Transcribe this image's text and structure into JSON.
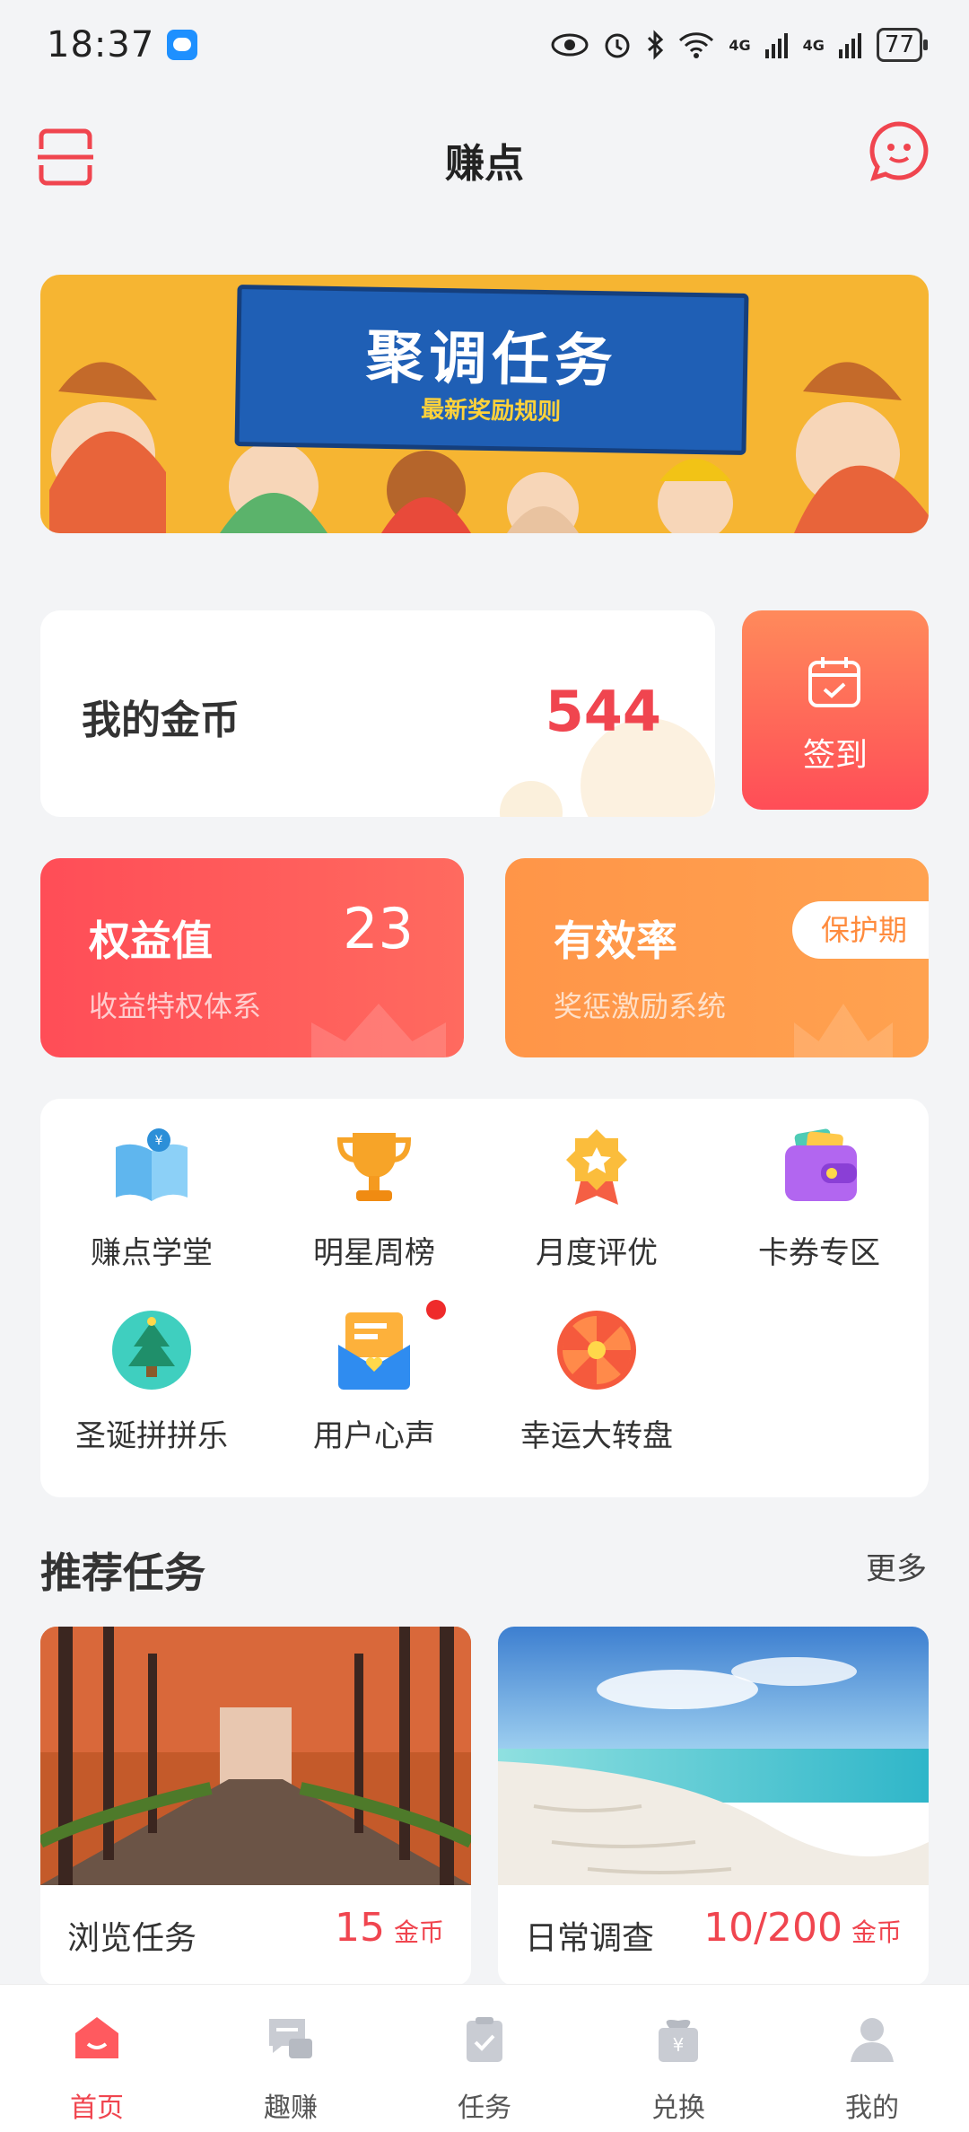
{
  "status_bar": {
    "time": "18:37",
    "battery": "77",
    "signal_labels": [
      "4G",
      "4G"
    ]
  },
  "header": {
    "title": "赚点"
  },
  "banner": {
    "title": "聚调任务",
    "subtitle": "最新奖励规则"
  },
  "coins": {
    "label": "我的金币",
    "value": "544"
  },
  "signin": {
    "label": "签到"
  },
  "rights": {
    "title": "权益值",
    "subtitle": "收益特权体系",
    "value": "23"
  },
  "efficiency": {
    "title": "有效率",
    "subtitle": "奖惩激励系统",
    "badge": "保护期"
  },
  "grid": {
    "items": [
      {
        "label": "赚点学堂",
        "icon": "book-icon"
      },
      {
        "label": "明星周榜",
        "icon": "trophy-icon"
      },
      {
        "label": "月度评优",
        "icon": "medal-icon"
      },
      {
        "label": "卡券专区",
        "icon": "wallet-icon"
      },
      {
        "label": "圣诞拼拼乐",
        "icon": "christmas-tree-icon"
      },
      {
        "label": "用户心声",
        "icon": "mail-heart-icon"
      },
      {
        "label": "幸运大转盘",
        "icon": "lucky-wheel-icon"
      }
    ]
  },
  "recommend": {
    "title": "推荐任务",
    "more": "更多"
  },
  "tasks": [
    {
      "name": "浏览任务",
      "reward": "15",
      "unit": "金币"
    },
    {
      "name": "日常调查",
      "reward": "10/200",
      "unit": "金币"
    }
  ],
  "tabbar": {
    "items": [
      {
        "label": "首页",
        "icon": "home-icon",
        "active": true
      },
      {
        "label": "趣赚",
        "icon": "chat-icon"
      },
      {
        "label": "任务",
        "icon": "clipboard-icon"
      },
      {
        "label": "兑换",
        "icon": "gift-icon"
      },
      {
        "label": "我的",
        "icon": "user-icon"
      }
    ]
  },
  "colors": {
    "accent": "#f0454f",
    "orange": "#ff9548",
    "background": "#f3f4f6"
  }
}
